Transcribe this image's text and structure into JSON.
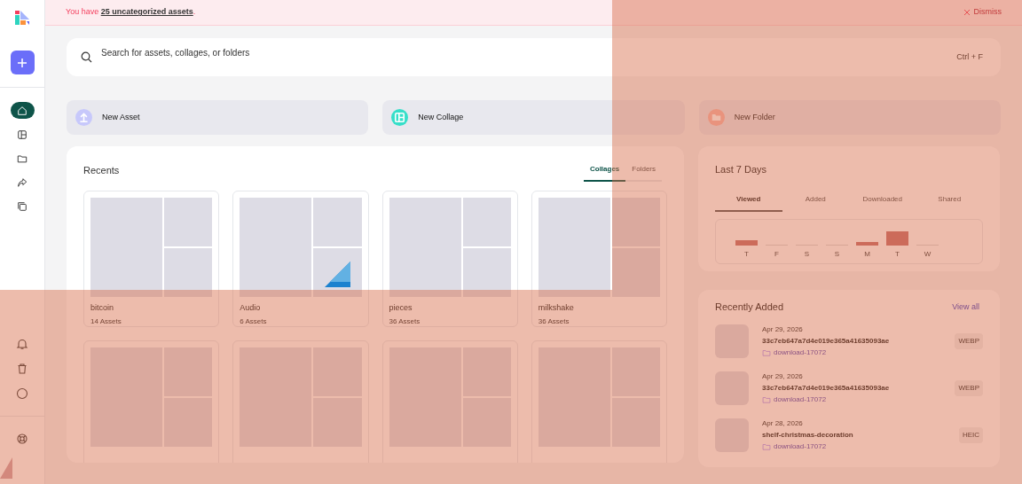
{
  "sidebar": {
    "nav": [
      {
        "kind": "home",
        "selected": true
      },
      {
        "kind": "collage",
        "selected": false
      },
      {
        "kind": "folder",
        "selected": false
      },
      {
        "kind": "share",
        "selected": false
      },
      {
        "kind": "copy",
        "selected": false
      }
    ],
    "bottom": [
      {
        "kind": "bell"
      },
      {
        "kind": "trash"
      },
      {
        "kind": "circle"
      },
      {
        "kind": "help"
      }
    ]
  },
  "banner": {
    "text": "You have **25 uncategorized assets**.",
    "dismiss": "Dismiss"
  },
  "search": {
    "placeholder": "Search for assets, collages, or folders",
    "shortcut": "Ctrl + F"
  },
  "actions": [
    {
      "kind": "asset",
      "label": "New Asset"
    },
    {
      "kind": "collage",
      "label": "New Collage"
    },
    {
      "kind": "folder",
      "label": "New Folder"
    }
  ],
  "recents": {
    "title": "Recents",
    "tabs": [
      {
        "label": "Collages",
        "selected": true
      },
      {
        "label": "Folders",
        "selected": false
      }
    ],
    "items": [
      {
        "title": "bitcoin",
        "count": "14 Assets"
      },
      {
        "title": "Audio",
        "count": "6 Assets",
        "corner_icon": true
      },
      {
        "title": "pieces",
        "count": "36 Assets"
      },
      {
        "title": "milkshake",
        "count": "36 Assets"
      },
      {
        "kind": "blank"
      },
      {
        "kind": "blank"
      },
      {
        "kind": "blank"
      },
      {
        "kind": "blank"
      }
    ]
  },
  "last_7_days": {
    "title": "Last 7 Days",
    "tabs": [
      {
        "label": "Viewed",
        "selected": true
      },
      {
        "label": "Added",
        "selected": false
      },
      {
        "label": "Downloaded",
        "selected": false
      },
      {
        "label": "Shared",
        "selected": false
      }
    ],
    "days": [
      "T",
      "F",
      "S",
      "S",
      "M",
      "T",
      "W"
    ]
  },
  "recently_added": {
    "title": "Recently Added",
    "view_all": "View all",
    "items": [
      {
        "date": "Apr 29, 2026",
        "name": "33c7eb647a7d4e019e365a41635093ae",
        "folder": "download-17072",
        "type": "WEBP"
      },
      {
        "date": "Apr 29, 2026",
        "name": "33c7eb647a7d4e019e365a41635093ae",
        "folder": "download-17072",
        "type": "WEBP"
      },
      {
        "date": "Apr 28, 2026",
        "name": "shelf-christmas-decoration",
        "folder": "download-17072",
        "type": "HEIC"
      }
    ]
  }
}
